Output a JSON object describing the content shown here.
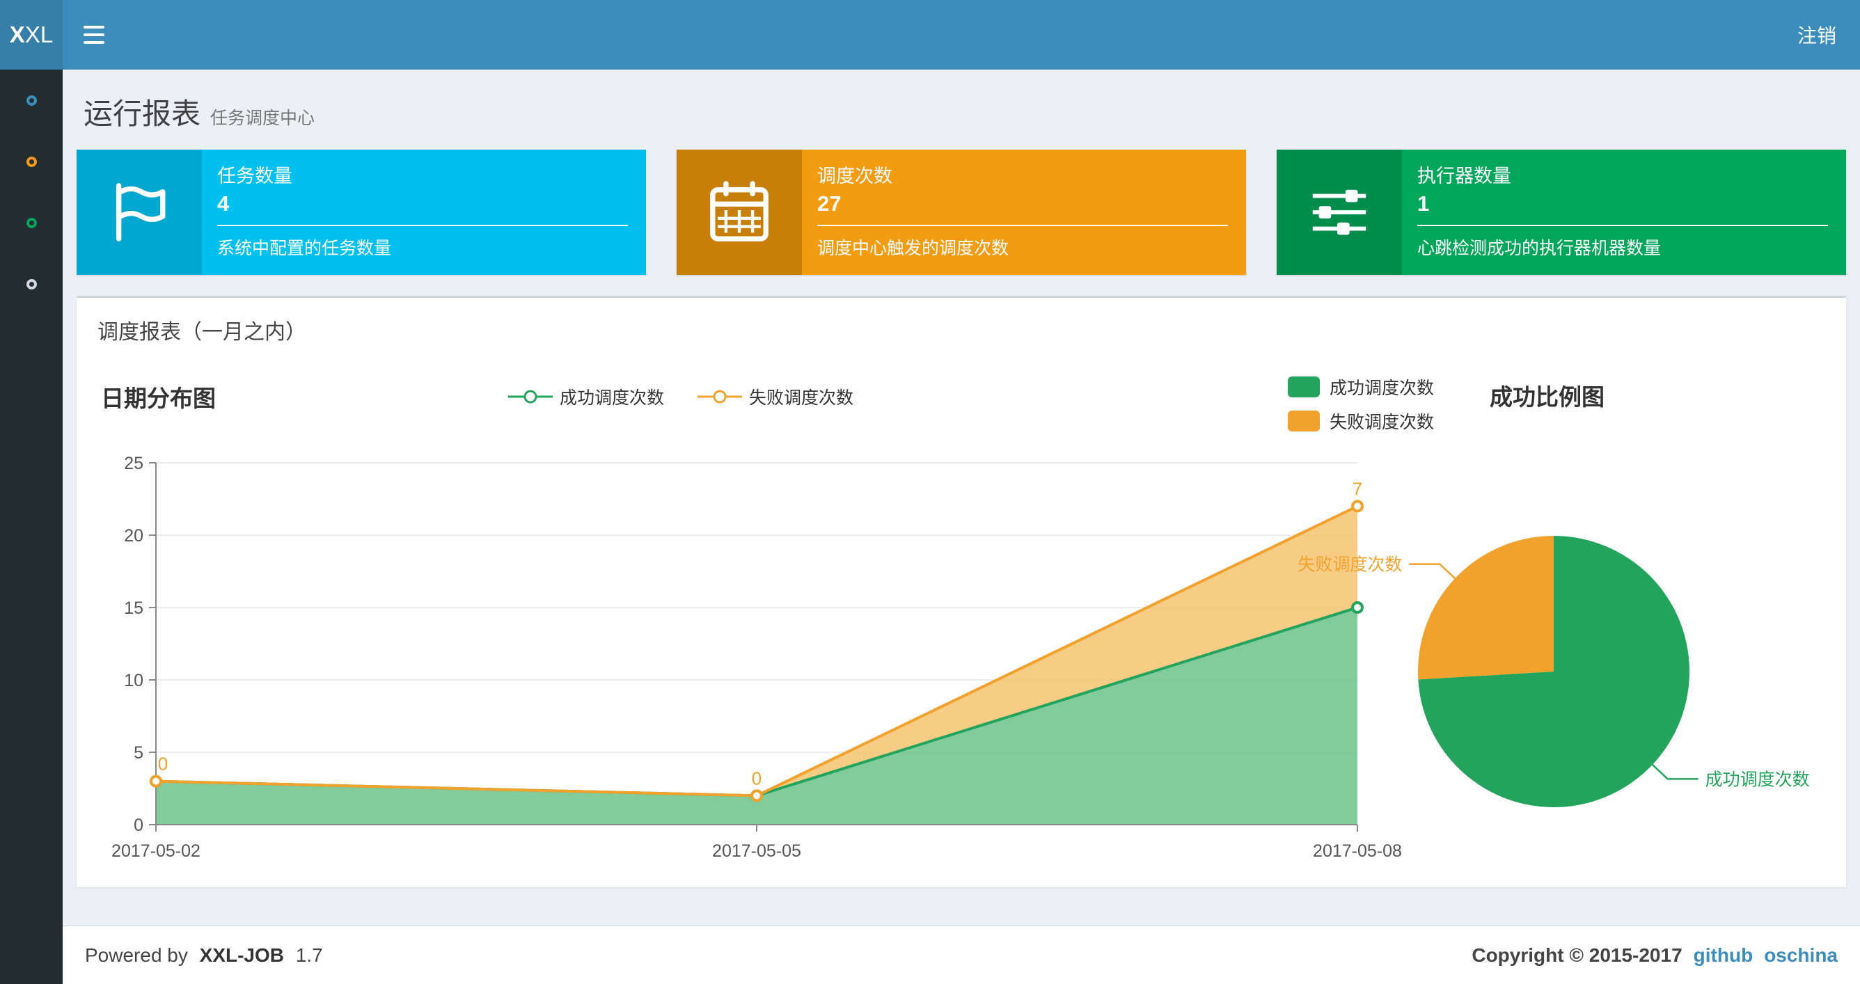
{
  "colors": {
    "header_bg": "#3c8dbc",
    "logo_bg": "#367fa9",
    "sidebar_bg": "#222d32",
    "body_bg": "#ecf0f5",
    "success_green": "#23a45c",
    "success_green_fill": "#6cc289",
    "fail_orange": "#f1a22d",
    "fail_orange_fill": "#f6c36e",
    "link_blue": "#3c8dbc"
  },
  "header": {
    "logo_bold": "X",
    "logo_rest": "XL",
    "logout_label": "注销"
  },
  "sidebar": {
    "items": [
      {
        "icon": "circle-outline-icon",
        "color": "#3c8dbc"
      },
      {
        "icon": "circle-outline-icon",
        "color": "#f39c12"
      },
      {
        "icon": "circle-outline-icon",
        "color": "#00a65a"
      },
      {
        "icon": "circle-outline-icon",
        "color": "#d2d6de"
      }
    ]
  },
  "page": {
    "title": "运行报表",
    "subtitle": "任务调度中心"
  },
  "info_boxes": [
    {
      "icon": "flag-icon",
      "bg": "#00c0ef",
      "icon_bg": "#00a7d0",
      "label": "任务数量",
      "value": "4",
      "desc": "系统中配置的任务数量"
    },
    {
      "icon": "calendar-icon",
      "bg": "#f39c12",
      "icon_bg": "#c87f0a",
      "label": "调度次数",
      "value": "27",
      "desc": "调度中心触发的调度次数"
    },
    {
      "icon": "sliders-icon",
      "bg": "#00a65a",
      "icon_bg": "#008d4c",
      "label": "执行器数量",
      "value": "1",
      "desc": "心跳检测成功的执行器机器数量"
    }
  ],
  "panel": {
    "title": "调度报表（一月之内）"
  },
  "chart_data": [
    {
      "type": "area",
      "title": "日期分布图",
      "x": [
        "2017-05-02",
        "2017-05-05",
        "2017-05-08"
      ],
      "stacked": true,
      "grid": true,
      "legend_position": "top",
      "ylim": [
        0,
        25
      ],
      "yticks": [
        0,
        5,
        10,
        15,
        20,
        25
      ],
      "series": [
        {
          "name": "成功调度次数",
          "values": [
            3,
            2,
            15
          ],
          "color": "#23a45c",
          "fill": "#6cc289"
        },
        {
          "name": "失败调度次数",
          "values": [
            0,
            0,
            7
          ],
          "color": "#f1a22d",
          "fill": "#f6c36e",
          "point_labels": [
            "0",
            "0",
            "7"
          ]
        }
      ]
    },
    {
      "type": "pie",
      "title": "成功比例图",
      "legend_position": "top-left",
      "slices": [
        {
          "name": "成功调度次数",
          "value": 20,
          "color": "#23a45c"
        },
        {
          "name": "失败调度次数",
          "value": 7,
          "color": "#f1a22d"
        }
      ]
    }
  ],
  "footer": {
    "powered_prefix": "Powered by",
    "product": "XXL-JOB",
    "version": "1.7",
    "copyright": "Copyright © 2015-2017",
    "links": [
      {
        "label": "github"
      },
      {
        "label": "oschina"
      }
    ]
  }
}
